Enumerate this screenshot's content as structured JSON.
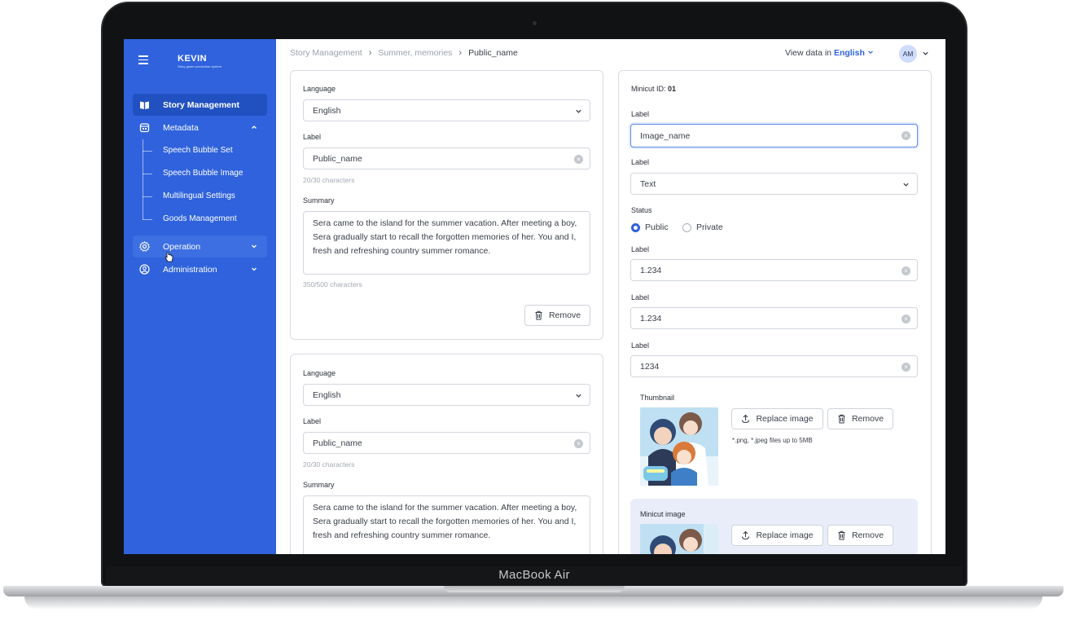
{
  "device": {
    "brand": "MacBook Air"
  },
  "sidebar": {
    "logo_title": "KEVIN",
    "logo_subtitle": "Story game production system",
    "items": [
      {
        "label": "Story Management",
        "icon": "book-icon",
        "active": true
      },
      {
        "label": "Metadata",
        "icon": "calendar-icon",
        "expanded": true
      },
      {
        "label": "Operation",
        "icon": "gear-icon",
        "expanded": false
      },
      {
        "label": "Administration",
        "icon": "user-circle-icon",
        "expanded": false
      }
    ],
    "metadata_children": [
      "Speech Bubble Set",
      "Speech Bubble Image",
      "Multilingual Settings",
      "Goods Management"
    ]
  },
  "header": {
    "breadcrumb": [
      "Story Management",
      "Summer, memories",
      "Public_name"
    ],
    "view_data_label": "View data in",
    "view_data_language": "English",
    "avatar_initials": "AM"
  },
  "left_cards": [
    {
      "language_label": "Language",
      "language_value": "English",
      "label_label": "Label",
      "label_value": "Public_name",
      "label_count": "20/30 characters",
      "summary_label": "Summary",
      "summary_value": "Sera came to the island for the summer vacation. After meeting a boy, Sera gradually start to recall the forgotten memories of her. You and I, fresh and refreshing country summer romance.",
      "summary_count": "350/500 characters",
      "remove_label": "Remove"
    },
    {
      "language_label": "Language",
      "language_value": "English",
      "label_label": "Label",
      "label_value": "Public_name",
      "label_count": "20/30 characters",
      "summary_label": "Summary",
      "summary_value": "Sera came to the island for the summer vacation. After meeting a boy, Sera gradually start to recall the forgotten memories of her. You and I, fresh and refreshing country summer romance."
    }
  ],
  "right_card": {
    "minicut_prefix": "Minicut ID:",
    "minicut_id": "01",
    "label1_label": "Label",
    "label1_value": "Image_name",
    "label2_label": "Label",
    "label2_value": "Text",
    "status_label": "Status",
    "status_options": [
      "Public",
      "Private"
    ],
    "status_selected": "Public",
    "label3_label": "Label",
    "label3_value": "1.234",
    "label4_label": "Label",
    "label4_value": "1.234",
    "label5_label": "Label",
    "label5_value": "1234",
    "thumbnail_label": "Thumbnail",
    "replace_label": "Replace image",
    "remove_label": "Remove",
    "file_hint": "*.png, *.jpeg files up to 5MB",
    "minicut_image_label": "Minicut image",
    "minicut_replace_label": "Replace image",
    "minicut_remove_label": "Remove"
  },
  "colors": {
    "primary": "#2f62dc",
    "sidebar_active": "#2150c0",
    "minicut_bg": "#e9edf9"
  }
}
